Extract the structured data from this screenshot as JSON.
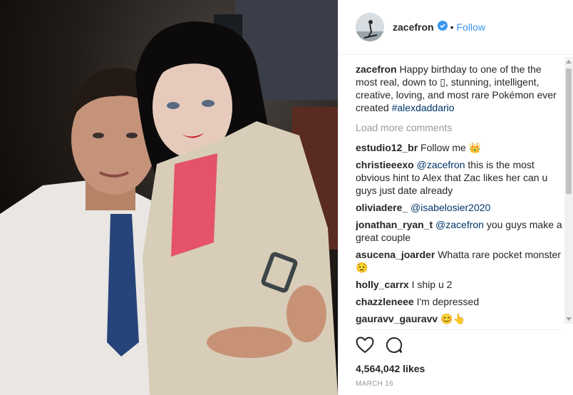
{
  "post": {
    "photo_alt": "Photo of a man in a white shirt and navy tie with a dark-haired woman in a beige trench coat",
    "username": "zacefron",
    "follow_label": "Follow",
    "separator": "•",
    "caption_user": "zacefron",
    "caption_text": "Happy birthday to one of the the most real, down to ▯, stunning, intelligent, creative, loving, and most rare Pokémon ever created ",
    "caption_tag": "#alexdaddario",
    "load_more": "Load more comments",
    "likes": "4,564,042 likes",
    "date": "MARCH 16"
  },
  "comments": [
    {
      "user": "estudio12_br",
      "text": "Follow me 👑"
    },
    {
      "user": "christieeexo",
      "mention": "@zacefron",
      "text": " this is the most obvious hint to Alex that Zac likes her can u guys just date already"
    },
    {
      "user": "oliviadere_",
      "mention": "@isabelosier2020",
      "text": ""
    },
    {
      "user": "jonathan_ryan_t",
      "mention": "@zacefron",
      "text": " you guys make a great couple"
    },
    {
      "user": "asucena_joarder",
      "text": "Whatta rare pocket monster 😟"
    },
    {
      "user": "holly_carrx",
      "text": "I ship u 2"
    },
    {
      "user": "chazzleneee",
      "text": "I'm depressed"
    },
    {
      "user": "gauravv_gauravv",
      "text": "😊👆"
    }
  ],
  "icons": {
    "like": "heart-icon",
    "comment": "comment-icon",
    "verified": "verified-badge-icon"
  },
  "colors": {
    "link": "#003569",
    "follow": "#3897f0",
    "verified": "#3897f0"
  }
}
